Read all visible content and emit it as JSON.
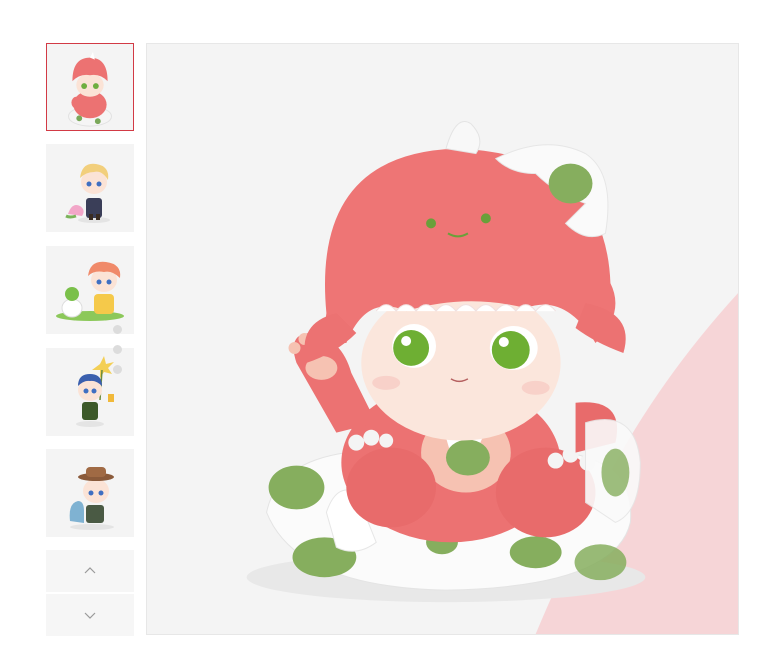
{
  "gallery": {
    "thumbnails": [
      {
        "name": "pink-dino-figure",
        "accent": "#f07272",
        "selected": true
      },
      {
        "name": "blonde-figure-with-pink-unicorn",
        "accent": "#f2cf7c",
        "selected": false
      },
      {
        "name": "figure-with-green-dino-in-egg",
        "accent": "#f08a6a",
        "selected": false
      },
      {
        "name": "blue-cap-figure-with-flower",
        "accent": "#3a5fae",
        "selected": false
      },
      {
        "name": "brown-hat-figure-with-blue-dino",
        "accent": "#8a5a3a",
        "selected": false
      }
    ],
    "nav": {
      "up_icon": "chevron-up-icon",
      "down_icon": "chevron-down-icon"
    },
    "main_image": {
      "name": "pink-dino-baby-hatching-from-egg",
      "body_color": "#ec7272",
      "spot_color": "#7aa85a"
    },
    "colors": {
      "selected_border": "#d23a45",
      "thumb_bg": "#f4f4f4"
    }
  }
}
